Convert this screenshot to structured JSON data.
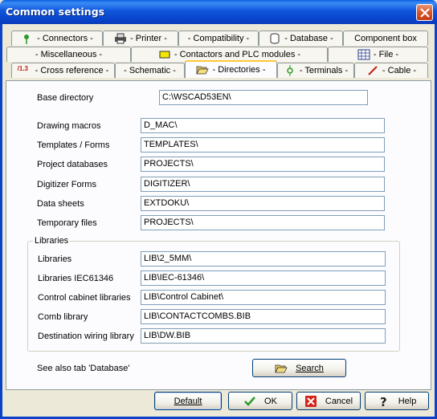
{
  "window": {
    "title": "Common settings"
  },
  "tabs": {
    "row1": [
      {
        "label": "- Connectors -",
        "icon": "connector-icon"
      },
      {
        "label": "- Printer -",
        "icon": "printer-icon"
      },
      {
        "label": "- Compatibility -"
      },
      {
        "label": "- Database -",
        "icon": "database-icon"
      },
      {
        "label": "Component box"
      }
    ],
    "row2": [
      {
        "label": "- Miscellaneous -"
      },
      {
        "label": "- Contactors and PLC modules -",
        "icon": "contactor-icon"
      },
      {
        "label": "- File -",
        "icon": "grid-file-icon"
      }
    ],
    "row3": [
      {
        "label": "- Cross reference -",
        "icon": "cross-reference-icon",
        "icon_text": "/1.3"
      },
      {
        "label": "- Schematic -"
      },
      {
        "label": "- Directories -",
        "icon": "folder-open-icon",
        "active": true
      },
      {
        "label": "- Terminals -",
        "icon": "terminal-icon"
      },
      {
        "label": "- Cable -",
        "icon": "cable-icon"
      }
    ]
  },
  "directories": {
    "base": {
      "label": "Base directory",
      "value": "C:\\WSCAD53EN\\"
    },
    "fields": [
      {
        "label": "Drawing macros",
        "value": "D_MAC\\"
      },
      {
        "label": "Templates / Forms",
        "value": "TEMPLATES\\"
      },
      {
        "label": "Project databases",
        "value": "PROJECTS\\"
      },
      {
        "label": "Digitizer Forms",
        "value": "DIGITIZER\\"
      },
      {
        "label": "Data sheets",
        "value": "EXTDOKU\\"
      },
      {
        "label": "Temporary files",
        "value": "PROJECTS\\"
      }
    ],
    "libraries": {
      "title": "Libraries",
      "fields": [
        {
          "label": "Libraries",
          "value": "LIB\\2_5MM\\"
        },
        {
          "label": "Libraries IEC61346",
          "value": "LIB\\IEC-61346\\"
        },
        {
          "label": "Control cabinet libraries",
          "value": "LIB\\Control Cabinet\\"
        },
        {
          "label": "Comb library",
          "value": "LIB\\CONTACTCOMBS.BIB"
        },
        {
          "label": "Destination wiring library",
          "value": "LIB\\DW.BIB"
        }
      ]
    },
    "see_also": "See also tab 'Database'",
    "search_label": "Search"
  },
  "buttons": {
    "default": "Default",
    "ok": "OK",
    "cancel": "Cancel",
    "help": "Help"
  },
  "colors": {
    "titlebar": "#0a43c7",
    "active_tab_highlight": "#ffc83c",
    "ok_check": "#2c9a2c",
    "cancel_x": "#d4241a"
  }
}
